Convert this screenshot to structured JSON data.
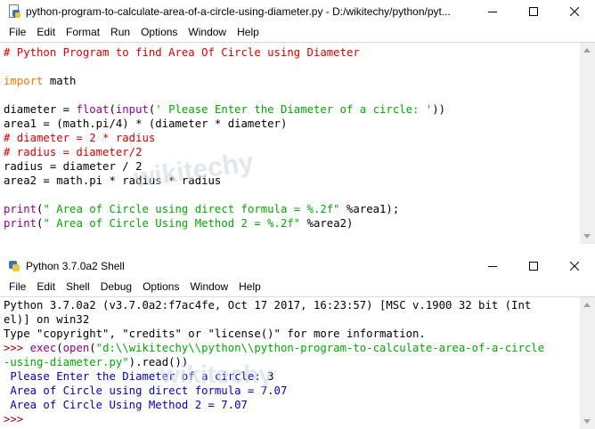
{
  "editor_window": {
    "title": "python-program-to-calculate-area-of-a-circle-using-diameter.py - D:/wikitechy/python/pyt...",
    "menu": [
      "File",
      "Edit",
      "Format",
      "Run",
      "Options",
      "Window",
      "Help"
    ],
    "code_lines": [
      [
        {
          "t": "# Python Program to find Area Of Circle using Diameter",
          "c": "cm"
        }
      ],
      [],
      [
        {
          "t": "import",
          "c": "kw"
        },
        {
          "t": " math",
          "c": "df"
        }
      ],
      [],
      [
        {
          "t": "diameter = ",
          "c": "df"
        },
        {
          "t": "float",
          "c": "bi"
        },
        {
          "t": "(",
          "c": "df"
        },
        {
          "t": "input",
          "c": "bi"
        },
        {
          "t": "(",
          "c": "df"
        },
        {
          "t": "' Please Enter the Diameter of a circle: '",
          "c": "st"
        },
        {
          "t": "))",
          "c": "df"
        }
      ],
      [
        {
          "t": "area1 = (math.pi/4) * (diameter * diameter)",
          "c": "df"
        }
      ],
      [
        {
          "t": "# diameter = 2 * radius",
          "c": "cm"
        }
      ],
      [
        {
          "t": "# radius = diameter/2",
          "c": "cm"
        }
      ],
      [
        {
          "t": "radius = diameter / 2",
          "c": "df"
        }
      ],
      [
        {
          "t": "area2 = math.pi * radius * radius",
          "c": "df"
        }
      ],
      [],
      [
        {
          "t": "print",
          "c": "bi"
        },
        {
          "t": "(",
          "c": "df"
        },
        {
          "t": "\" Area of Circle using direct formula = %.2f\"",
          "c": "st"
        },
        {
          "t": " %area1);",
          "c": "df"
        }
      ],
      [
        {
          "t": "print",
          "c": "bi"
        },
        {
          "t": "(",
          "c": "df"
        },
        {
          "t": "\" Area of Circle Using Method 2 = %.2f\"",
          "c": "st"
        },
        {
          "t": " %area2)",
          "c": "df"
        }
      ]
    ]
  },
  "shell_window": {
    "title": "Python 3.7.0a2 Shell",
    "menu": [
      "File",
      "Edit",
      "Shell",
      "Debug",
      "Options",
      "Window",
      "Help"
    ],
    "lines": [
      [
        {
          "t": "Python 3.7.0a2 (v3.7.0a2:f7ac4fe, Oct 17 2017, 16:23:57) [MSC v.1900 32 bit (Int",
          "c": "df"
        }
      ],
      [
        {
          "t": "el)] on win32",
          "c": "df"
        }
      ],
      [
        {
          "t": "Type \"copyright\", \"credits\" or \"license()\" for more information.",
          "c": "df"
        }
      ],
      [
        {
          "t": ">>> ",
          "c": "pr"
        },
        {
          "t": "exec",
          "c": "bi"
        },
        {
          "t": "(",
          "c": "df"
        },
        {
          "t": "open",
          "c": "bi"
        },
        {
          "t": "(",
          "c": "df"
        },
        {
          "t": "\"d:\\\\wikitechy\\\\python\\\\python-program-to-calculate-area-of-a-circle",
          "c": "st"
        }
      ],
      [
        {
          "t": "-using-diameter.py\"",
          "c": "st"
        },
        {
          "t": ").read())",
          "c": "df"
        }
      ],
      [
        {
          "t": " Please Enter the Diameter of a circle: ",
          "c": "out"
        },
        {
          "t": "3",
          "c": "df"
        }
      ],
      [
        {
          "t": " Area of Circle using direct formula = 7.07",
          "c": "out"
        }
      ],
      [
        {
          "t": " Area of Circle Using Method 2 = 7.07",
          "c": "out"
        }
      ],
      [
        {
          "t": ">>> ",
          "c": "pr"
        }
      ]
    ]
  },
  "icons": {
    "app": "python-file-icon",
    "minimize": "minimize-icon",
    "maximize": "maximize-icon",
    "close": "close-icon"
  },
  "watermark": "wikitechy"
}
